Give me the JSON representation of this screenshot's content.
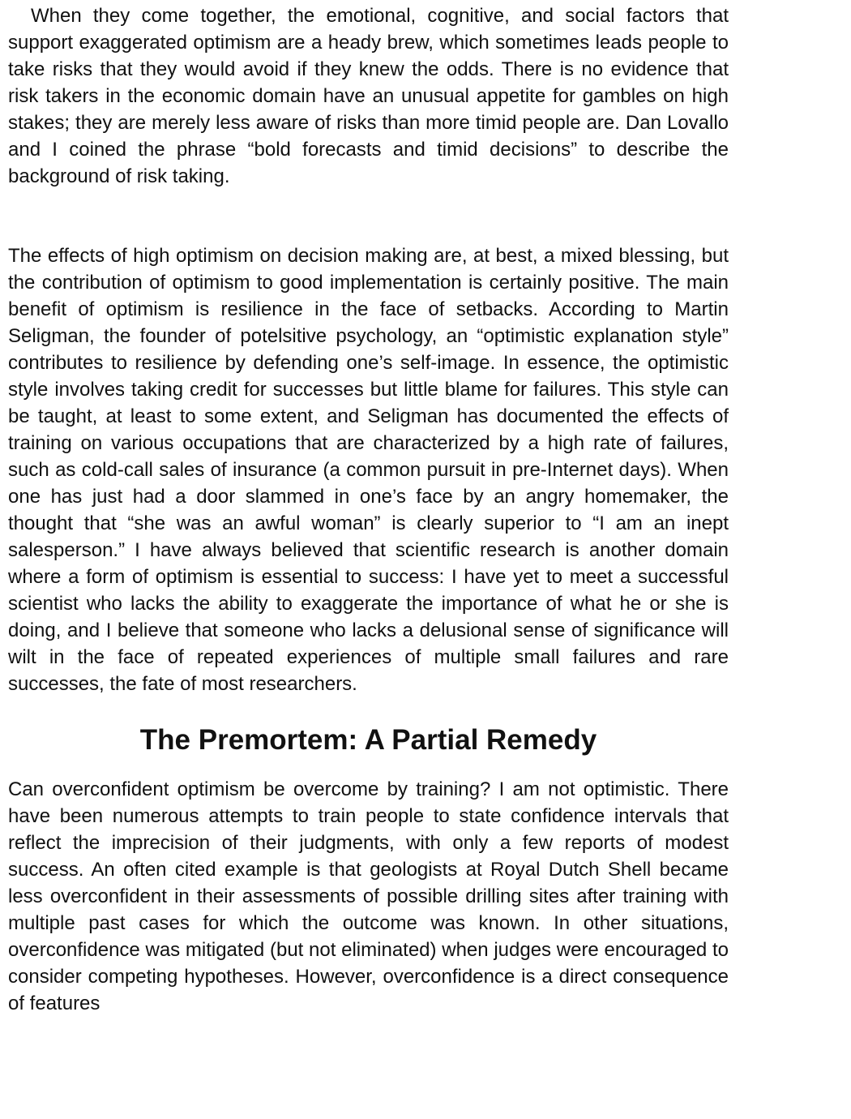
{
  "paragraphs": {
    "p1": "When they come together, the emotional, cognitive, and social factors that support exaggerated optimism are a heady brew, which sometimes leads people to take risks that they would avoid if they knew the odds. There is no evidence that risk takers in the economic domain have an unusual appetite for gambles on high stakes; they are merely less aware of risks than more timid people are. Dan Lovallo and I coined the phrase “bold forecasts and timid decisions” to describe the background of risk taking.",
    "p2": "The effects of high optimism on decision making are, at best, a mixed blessing, but the contribution of optimism to good implementation is certainly positive. The main benefit of optimism is resilience in the face of setbacks. According to Martin Seligman, the founder of potelsitive psychology, an “optimistic explanation style” contributes to resilience by defending one’s self-image. In essence, the optimistic style involves taking credit for successes but little blame for failures. This style can be taught, at least to some extent, and Seligman has documented the effects of training on various occupations that are characterized by a high rate of failures, such as cold-call sales of insurance (a common pursuit in pre-Internet days). When one has just had a door slammed in one’s face by an angry homemaker, the thought that “she was an awful woman” is clearly superior to “I am an inept salesperson.” I have always believed that scientific research is another domain where a form of optimism is essential to success: I have yet to meet a successful scientist who lacks the ability to exaggerate the importance of what he or she is doing, and I believe that someone who lacks a delusional sense of significance will wilt in the face of repeated experiences of multiple small failures and rare successes, the fate of most researchers.",
    "heading": "The Premortem: A Partial Remedy",
    "p3": "Can overconfident optimism be overcome by training? I am not optimistic. There have been numerous attempts to train people to state confidence intervals that reflect the imprecision of their judgments, with only a few reports of modest success. An often cited example is that geologists at Royal Dutch Shell became less overconfident in their assessments of possible drilling sites after training with multiple past cases for which the outcome was known. In other situations, overconfidence was mitigated (but not eliminated) when judges were encouraged to consider competing hypotheses. However, overconfidence is a direct consequence of features"
  }
}
